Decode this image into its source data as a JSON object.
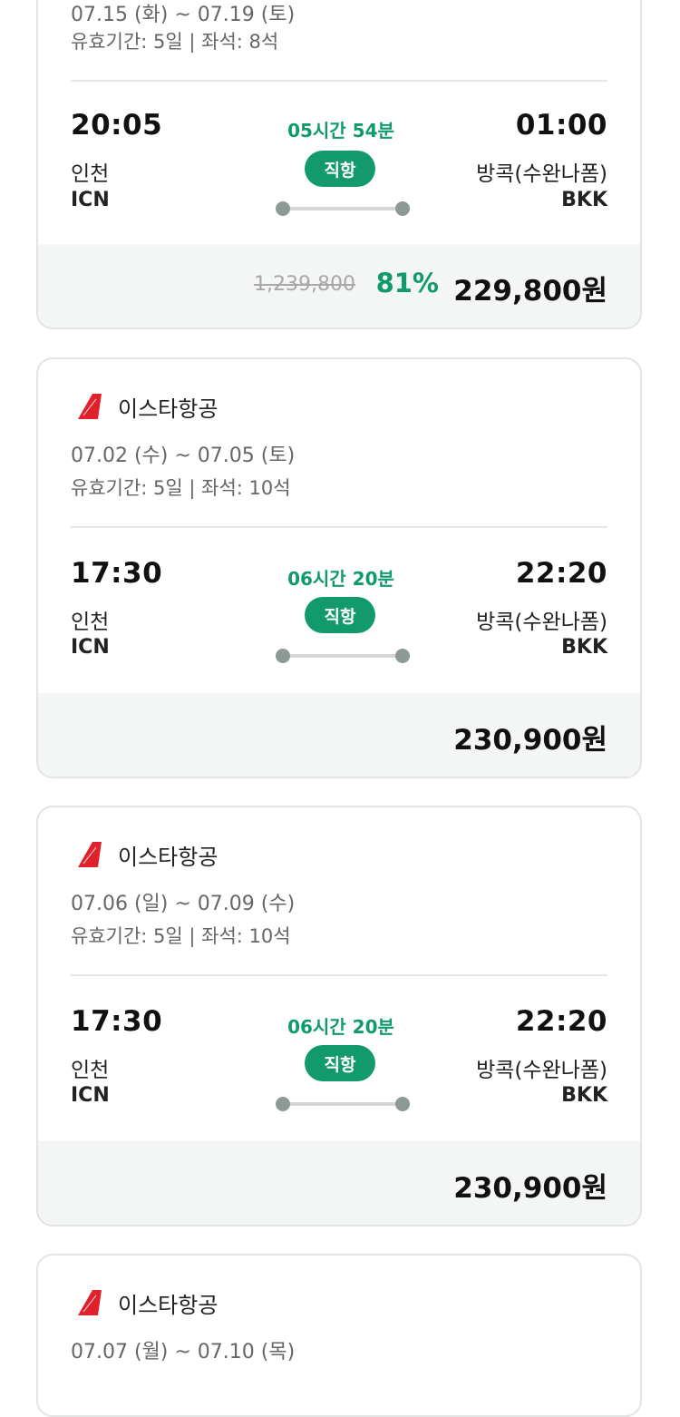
{
  "cards": [
    {
      "airline": "",
      "dates": "07.15 (화) ~ 07.19 (토)",
      "validity": "유효기간: 5일 | 좌석: 8석",
      "dep_time": "20:05",
      "dep_city": "인천",
      "dep_code": "ICN",
      "duration": "05시간 54분",
      "type": "직항",
      "arr_time": "01:00",
      "arr_city": "방콕(수완나폼)",
      "arr_code": "BKK",
      "original_price": "1,239,800",
      "discount": "81%",
      "price": "229,800원"
    },
    {
      "airline": "이스타항공",
      "dates": "07.02 (수) ~ 07.05 (토)",
      "validity": "유효기간: 5일 | 좌석: 10석",
      "dep_time": "17:30",
      "dep_city": "인천",
      "dep_code": "ICN",
      "duration": "06시간 20분",
      "type": "직항",
      "arr_time": "22:20",
      "arr_city": "방콕(수완나폼)",
      "arr_code": "BKK",
      "price": "230,900원"
    },
    {
      "airline": "이스타항공",
      "dates": "07.06 (일) ~ 07.09 (수)",
      "validity": "유효기간: 5일 | 좌석: 10석",
      "dep_time": "17:30",
      "dep_city": "인천",
      "dep_code": "ICN",
      "duration": "06시간 20분",
      "type": "직항",
      "arr_time": "22:20",
      "arr_city": "방콕(수완나폼)",
      "arr_code": "BKK",
      "price": "230,900원"
    },
    {
      "airline": "이스타항공",
      "dates": "07.07 (월) ~ 07.10 (목)"
    }
  ],
  "colors": {
    "accent": "#129a6c",
    "logo_red": "#e0202a",
    "price_bg": "#f4f5f5",
    "border": "#e2e4e3"
  },
  "icons": {
    "airline_logo": "eastar-jet-tail-icon"
  }
}
